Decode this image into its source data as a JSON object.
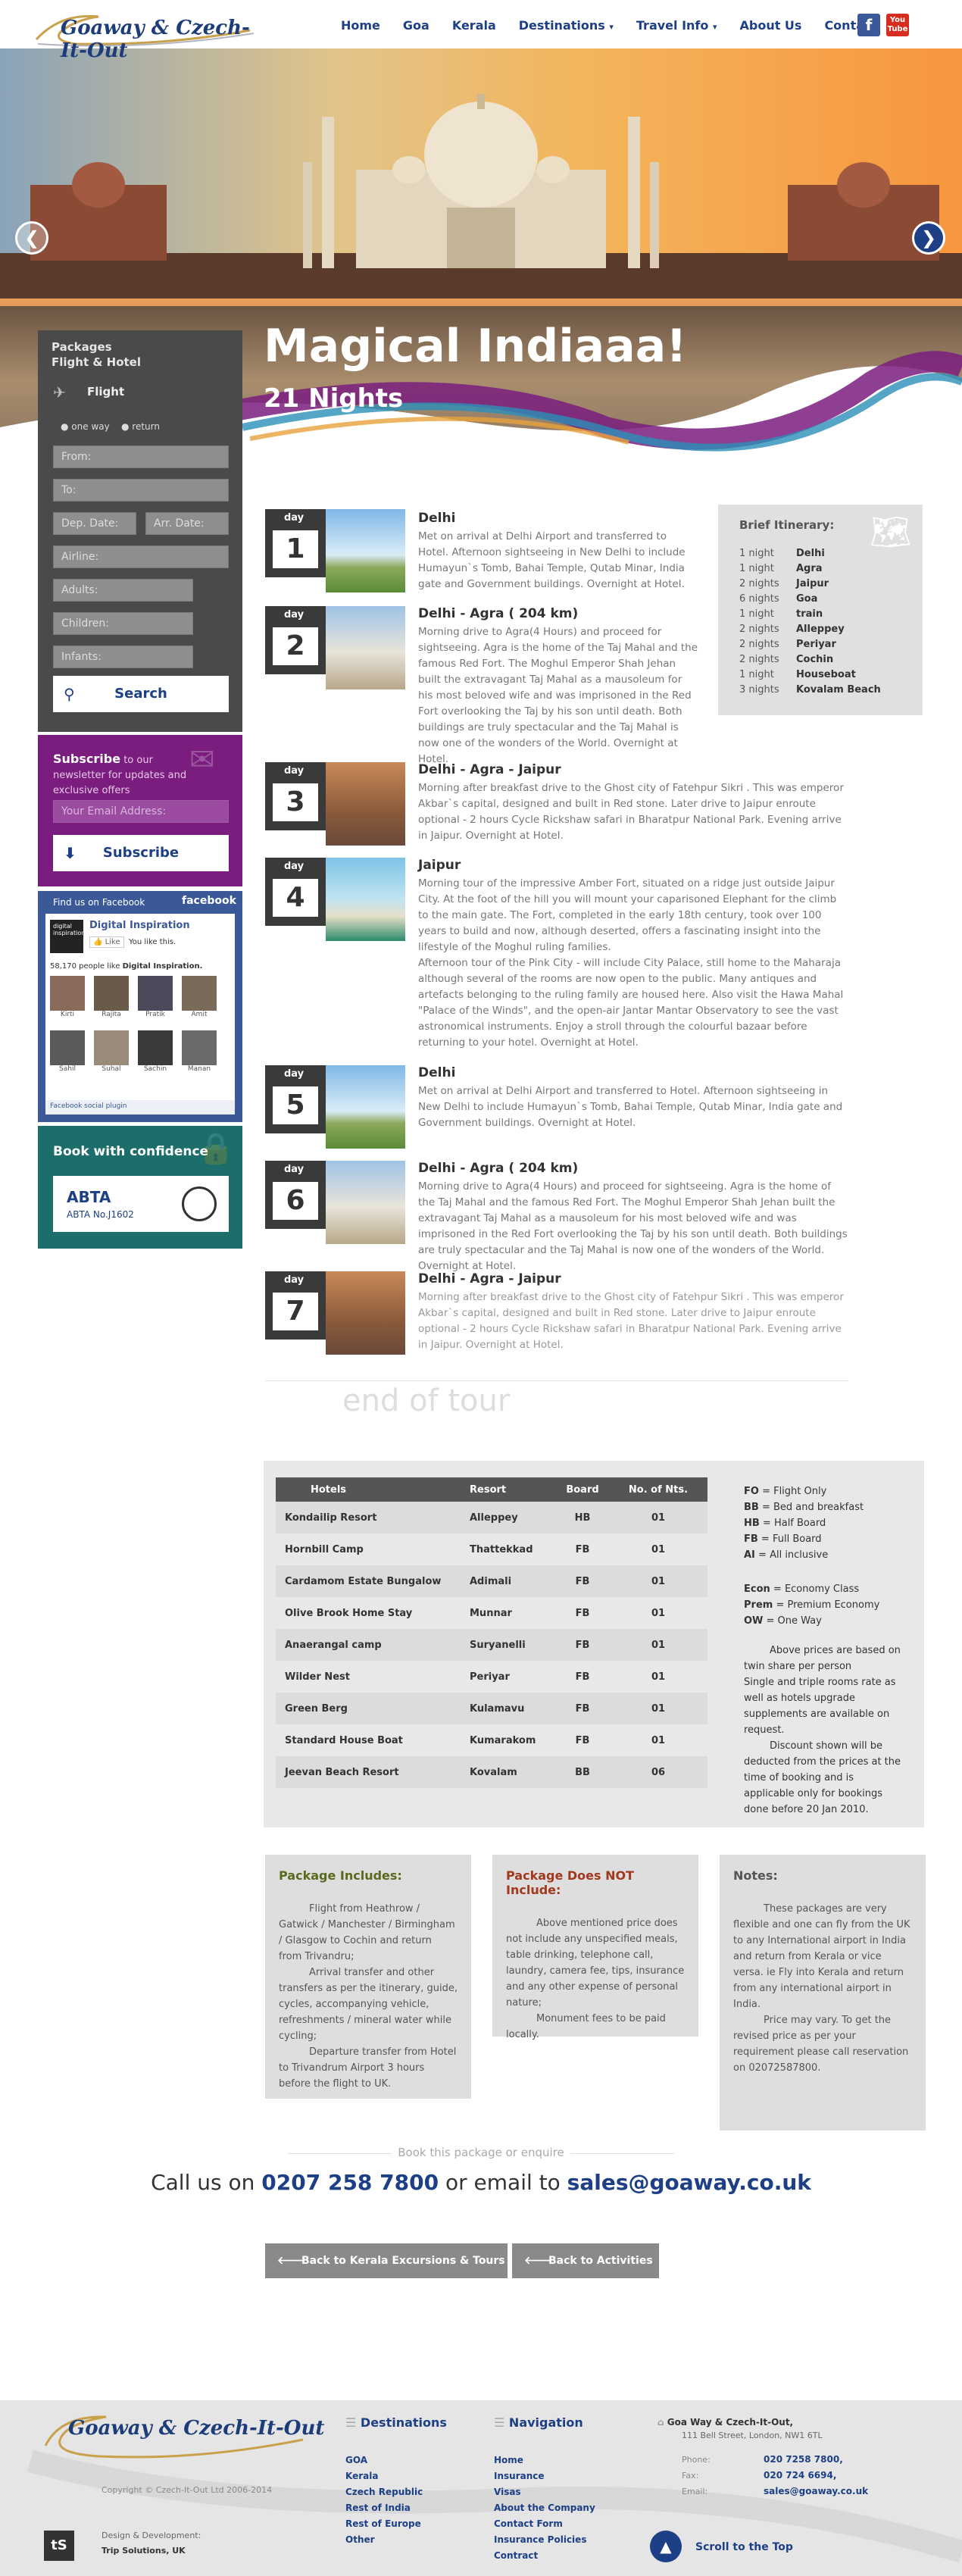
{
  "header": {
    "logo_text": "Goaway & Czech-It-Out",
    "nav": [
      "Home",
      "Goa",
      "Kerala",
      "Destinations",
      "Travel Info",
      "About Us",
      "Contact"
    ],
    "social": [
      "facebook-icon",
      "youtube-icon"
    ],
    "youtube_label": "You Tube"
  },
  "hero": {
    "title": "Magical Indiaaa!",
    "subtitle": "21 Nights",
    "prev": "❮",
    "next": "❯"
  },
  "search": {
    "heading1": "Packages",
    "heading2": "Flight & Hotel",
    "type_label": "Flight",
    "one_way": "one way",
    "return": "return",
    "from": "From:",
    "to": "To:",
    "dep_date": "Dep. Date:",
    "arr_date": "Arr. Date:",
    "airline": "Airline:",
    "adults": "Adults:",
    "children": "Children:",
    "infants": "Infants:",
    "button": "Search"
  },
  "subscribe": {
    "title": "Subscribe",
    "text": " to our newsletter for updates and exclusive offers",
    "placeholder": "Your Email Address:",
    "button": "Subscribe"
  },
  "facebook": {
    "find_us": "Find us on Facebook",
    "brand": "facebook",
    "page_name": "Digital Inspiration",
    "like_btn": "Like",
    "you_like": "You like this.",
    "people_count": "58,170 people like",
    "people_page": "Digital Inspiration.",
    "friends": [
      "Kirti",
      "Rajita",
      "Pratik",
      "Amit",
      "Sahil",
      "Suhal",
      "Sachin",
      "Manan"
    ],
    "plugin": "Facebook social plugin"
  },
  "confidence": {
    "title": "Book with confidence",
    "abta": "ABTA",
    "abta_no": "ABTA No.J1602"
  },
  "days": [
    {
      "label": "day",
      "num": "1",
      "title": "Delhi",
      "text": "Met on arrival at Delhi Airport and transferred to Hotel. Afternoon sightseeing in New Delhi to include Humayun`s Tomb, Bahai Temple, Qutab Minar, India gate and Government buildings. Overnight at Hotel."
    },
    {
      "label": "day",
      "num": "2",
      "title": "Delhi - Agra ( 204 km)",
      "text": "Morning drive to Agra(4 Hours) and proceed for sightseeing. Agra is the home of the Taj Mahal and the famous Red Fort. The Moghul Emperor Shah Jehan built the extravagant Taj Mahal as a mausoleum for his most beloved wife and was imprisoned in the Red Fort overlooking the Taj by his son until death. Both buildings are truly spectacular and the Taj Mahal is now one of the wonders of the World. Overnight at Hotel."
    },
    {
      "label": "day",
      "num": "3",
      "title": "Delhi - Agra - Jaipur",
      "text": "Morning after breakfast drive to the Ghost city of Fatehpur Sikri . This was emperor Akbar`s capital, designed and built in Red stone. Later drive to Jaipur enroute optional - 2 hours Cycle Rickshaw safari in Bharatpur National Park. Evening arrive in Jaipur. Overnight at Hotel."
    },
    {
      "label": "day",
      "num": "4",
      "title": "Jaipur",
      "text": "Morning tour of the impressive Amber Fort, situated on a ridge just outside Jaipur City. At the foot of the hill you will mount your caparisoned Elephant for the climb to the main gate. The Fort, completed in the early 18th century, took over 100 years to build and now, although deserted, offers a fascinating insight into the lifestyle of the Moghul ruling families.",
      "text2": "Afternoon tour of the Pink City - will include City Palace, still home to the Maharaja although several of the rooms are now open to the public. Many antiques and artefacts belonging to the ruling family are housed here. Also visit the Hawa Mahal \"Palace of the Winds\", and the open-air Jantar Mantar Observatory to see the vast astronomical instruments. Enjoy a stroll through the colourful bazaar before returning to your hotel. Overnight at Hotel."
    },
    {
      "label": "day",
      "num": "5",
      "title": "Delhi",
      "text": "Met on arrival at Delhi Airport and transferred to Hotel. Afternoon sightseeing in New Delhi to include Humayun`s Tomb, Bahai Temple, Qutab Minar, India gate and Government buildings. Overnight at Hotel."
    },
    {
      "label": "day",
      "num": "6",
      "title": "Delhi - Agra ( 204 km)",
      "text": "Morning drive to Agra(4 Hours) and proceed for sightseeing. Agra is the home of the Taj Mahal and the famous Red Fort. The Moghul Emperor Shah Jehan built the extravagant Taj Mahal as a mausoleum for his most beloved wife and was imprisoned in the Red Fort overlooking the Taj by his son until death. Both buildings are truly spectacular and the Taj Mahal is now one of the wonders of the World. Overnight at Hotel."
    },
    {
      "label": "day",
      "num": "7",
      "title": "Delhi - Agra - Jaipur",
      "text": "Morning after breakfast drive to the Ghost city of Fatehpur Sikri . This was emperor Akbar`s capital, designed and built in Red stone. Later drive to Jaipur enroute optional - 2 hours Cycle Rickshaw safari in Bharatpur National Park. Evening arrive in Jaipur. Overnight at Hotel."
    }
  ],
  "itinerary": {
    "title": "Brief Itinerary:",
    "rows": [
      {
        "n": "1 night",
        "p": "Delhi"
      },
      {
        "n": "1 night",
        "p": "Agra"
      },
      {
        "n": "2 nights",
        "p": "Jaipur"
      },
      {
        "n": "6 nights",
        "p": "Goa"
      },
      {
        "n": "1 night",
        "p": "train"
      },
      {
        "n": "2 nights",
        "p": "Alleppey"
      },
      {
        "n": "2 nights",
        "p": "Periyar"
      },
      {
        "n": "2 nights",
        "p": "Cochin"
      },
      {
        "n": "1 night",
        "p": "Houseboat"
      },
      {
        "n": "3 nights",
        "p": "Kovalam Beach"
      }
    ]
  },
  "end_of_tour": "end of tour",
  "hotels": {
    "headers": [
      "Hotels",
      "Resort",
      "Board",
      "No. of Nts."
    ],
    "rows": [
      [
        "Kondailip Resort",
        "Alleppey",
        "HB",
        "01"
      ],
      [
        "Hornbill Camp",
        "Thattekkad",
        "FB",
        "01"
      ],
      [
        "Cardamom Estate Bungalow",
        "Adimali",
        "FB",
        "01"
      ],
      [
        "Olive Brook Home Stay",
        "Munnar",
        "FB",
        "01"
      ],
      [
        "Anaerangal camp",
        "Suryanelli",
        "FB",
        "01"
      ],
      [
        "Wilder Nest",
        "Periyar",
        "FB",
        "01"
      ],
      [
        "Green Berg",
        "Kulamavu",
        "FB",
        "01"
      ],
      [
        "Standard House Boat",
        "Kumarakom",
        "FB",
        "01"
      ],
      [
        "Jeevan Beach Resort",
        "Kovalam",
        "BB",
        "06"
      ]
    ],
    "legend": [
      {
        "k": "FO",
        "v": " = Flight Only"
      },
      {
        "k": "BB",
        "v": " = Bed and breakfast"
      },
      {
        "k": "HB",
        "v": " = Half Board"
      },
      {
        "k": "FB",
        "v": " = Full Board"
      },
      {
        "k": "AI",
        "v": " = All inclusive"
      }
    ],
    "legend2": [
      {
        "k": "Econ",
        "v": " = Economy Class"
      },
      {
        "k": "Prem",
        "v": " = Premium Economy"
      },
      {
        "k": "OW",
        "v": " = One Way"
      }
    ],
    "note1": "Above prices are based on twin share per person",
    "note2": "Single and triple rooms rate as well as hotels upgrade supplements are available on request.",
    "note3": "Discount shown will be deducted from the prices at the time of booking and is applicable only for bookings done before 20 Jan 2010."
  },
  "includes": {
    "title": "Package Includes:",
    "p1": "Flight from Heathrow / Gatwick / Manchester / Birmingham / Glasgow to Cochin and return from Trivandru;",
    "p2": "Arrival transfer and other transfers as per the itinerary, guide, cycles, accompanying vehicle, refreshments / mineral water while cycling;",
    "p3": "Departure transfer from Hotel to Trivandrum Airport 3 hours before the flight to UK."
  },
  "not_includes": {
    "title": "Package Does NOT Include:",
    "p1": "Above mentioned price does not include any unspecified meals, table drinking, telephone call, laundry, camera fee, tips, insurance and any other expense of personal nature;",
    "p2": "Monument fees to be paid locally."
  },
  "notes": {
    "title": "Notes:",
    "p1": "These packages are very flexible and one can fly from the UK to any International airport in India and return from Kerala or vice versa. ie Fly into Kerala and return from any international airport in India.",
    "p2": "Price may vary. To get the revised price as per your requirement please call reservation on 02072587800."
  },
  "enquire": "Book this package or enquire",
  "call": {
    "pre": "Call us on ",
    "phone": "0207 258 7800",
    "mid": " or email to ",
    "email": "sales@goaway.co.uk"
  },
  "back_buttons": [
    "Back to Kerala Excursions & Tours",
    "Back to Activities"
  ],
  "footer": {
    "logo_text": "Goaway & Czech-It-Out",
    "copyright": "Copyright © Czech-It-Out Ltd 2006-2014",
    "design_by": "Design & Development:",
    "design_company": "Trip Solutions, UK",
    "ts_badge": "tS",
    "destinations_title": "Destinations",
    "destinations": [
      "GOA",
      "Kerala",
      "Czech Republic",
      "Rest of India",
      "Rest of Europe",
      "Other"
    ],
    "navigation_title": "Navigation",
    "navigation": [
      "Home",
      "Insurance",
      "Visas",
      "About the Company",
      "Contact Form",
      "Insurance Policies",
      "Contract"
    ],
    "company": "Goa Way & Czech-It-Out,",
    "address": "111 Bell Street, London, NW1 6TL",
    "phone_label": "Phone:",
    "phone": "020 7258 7800,",
    "fax_label": "Fax:",
    "fax": "020 724 6694,",
    "email_label": "Email:",
    "email": "sales@goaway.co.uk",
    "scroll_top": "Scroll to the Top"
  }
}
